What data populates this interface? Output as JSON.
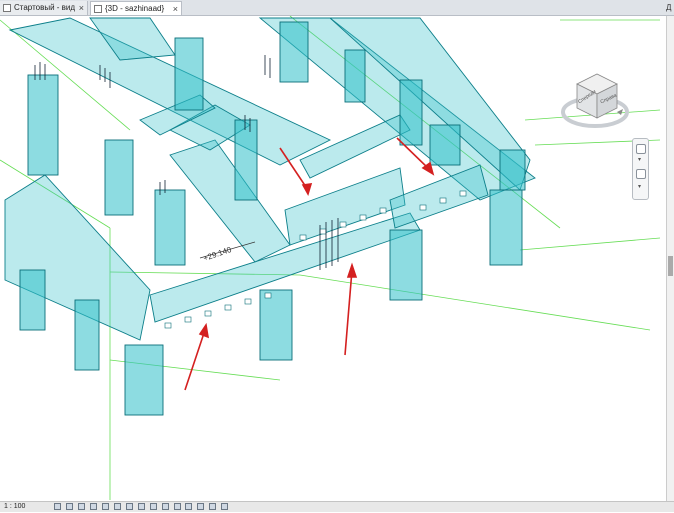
{
  "tabs": [
    {
      "label": "Стартовый - вид",
      "active": false
    },
    {
      "label": "{3D - sazhinaad}",
      "active": true
    }
  ],
  "tab_close_glyph": "×",
  "tab_overflow_label": "Д",
  "viewcube": {
    "face_front": "Спереди",
    "face_right": "Справа"
  },
  "annotation": {
    "elevation": "+29.140"
  },
  "statusbar": {
    "scale": "1 : 100"
  },
  "colors": {
    "structure": "#2fc0c8",
    "grid": "#66dd55",
    "arrows": "#d42020"
  },
  "icons": [
    "view-icon",
    "nav-wheel-icon",
    "zoom-icon",
    "section-icon"
  ]
}
